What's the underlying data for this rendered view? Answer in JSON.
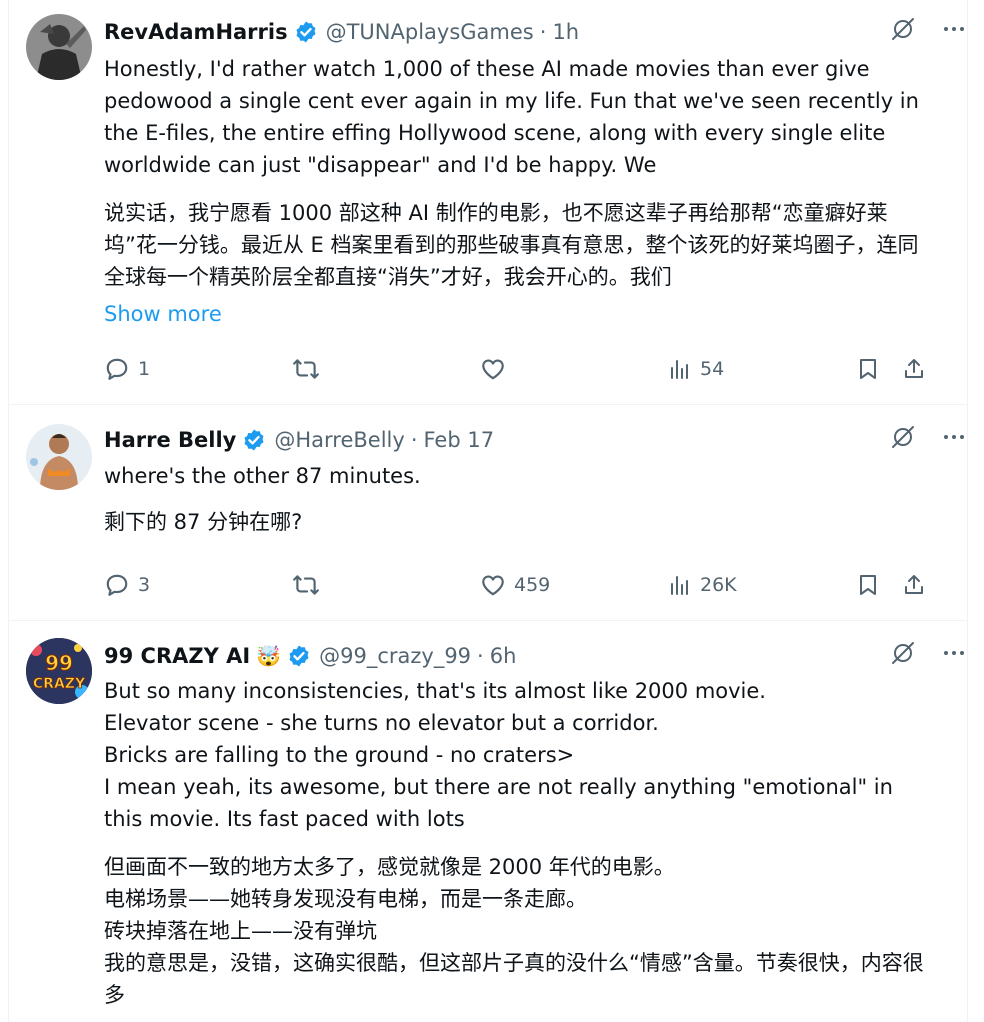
{
  "tweets": [
    {
      "name": "RevAdamHarris",
      "handle": "@TUNAplaysGames",
      "sep": "·",
      "time": "1h",
      "text_en": "Honestly, I'd rather watch 1,000 of these AI made movies than ever give pedowood a single cent ever again in my life. Fun that we've seen recently in the E-files, the entire effing Hollywood scene, along with every single elite worldwide can just \"disappear\" and I'd be happy. We",
      "text_zh": "说实话，我宁愿看 1000 部这种 AI 制作的电影，也不愿这辈子再给那帮“恋童癖好莱坞”花一分钱。最近从 E 档案里看到的那些破事真有意思，整个该死的好莱坞圈子，连同全球每一个精英阶层全都直接“消失”才好，我会开心的。我们",
      "show_more": "Show more",
      "replies": "1",
      "reposts": "",
      "likes": "",
      "views": "54"
    },
    {
      "name": "Harre Belly",
      "handle": "@HarreBelly",
      "sep": "·",
      "time": "Feb 17",
      "text_en": "where's the other 87 minutes.",
      "text_zh": "剩下的 87 分钟在哪?",
      "replies": "3",
      "reposts": "",
      "likes": "459",
      "views": "26K"
    },
    {
      "name": "99 CRAZY AI",
      "emoji": "🤯",
      "handle": "@99_crazy_99",
      "sep": "·",
      "time": "6h",
      "avatar_text_top": "99",
      "avatar_text_bottom": "CRAZY",
      "text_en_lines": [
        "But so many inconsistencies, that's its almost like 2000 movie.",
        "Elevator scene - she turns no elevator but a corridor.",
        "Bricks are falling to the ground - no craters>",
        "I mean yeah, its awesome, but there are not really anything \"emotional\" in this movie. Its fast paced with lots"
      ],
      "text_zh_lines": [
        "但画面不一致的地方太多了，感觉就像是 2000 年代的电影。",
        "电梯场景——她转身发现没有电梯，而是一条走廊。",
        "砖块掉落在地上——没有弹坑",
        "我的意思是，没错，这确实很酷，但这部片子真的没什么“情感”含量。节奏很快，内容很多"
      ]
    }
  ],
  "colors": {
    "accent": "#1d9bf0",
    "text": "#0f1419",
    "muted": "#536471",
    "border": "#eff3f4"
  }
}
